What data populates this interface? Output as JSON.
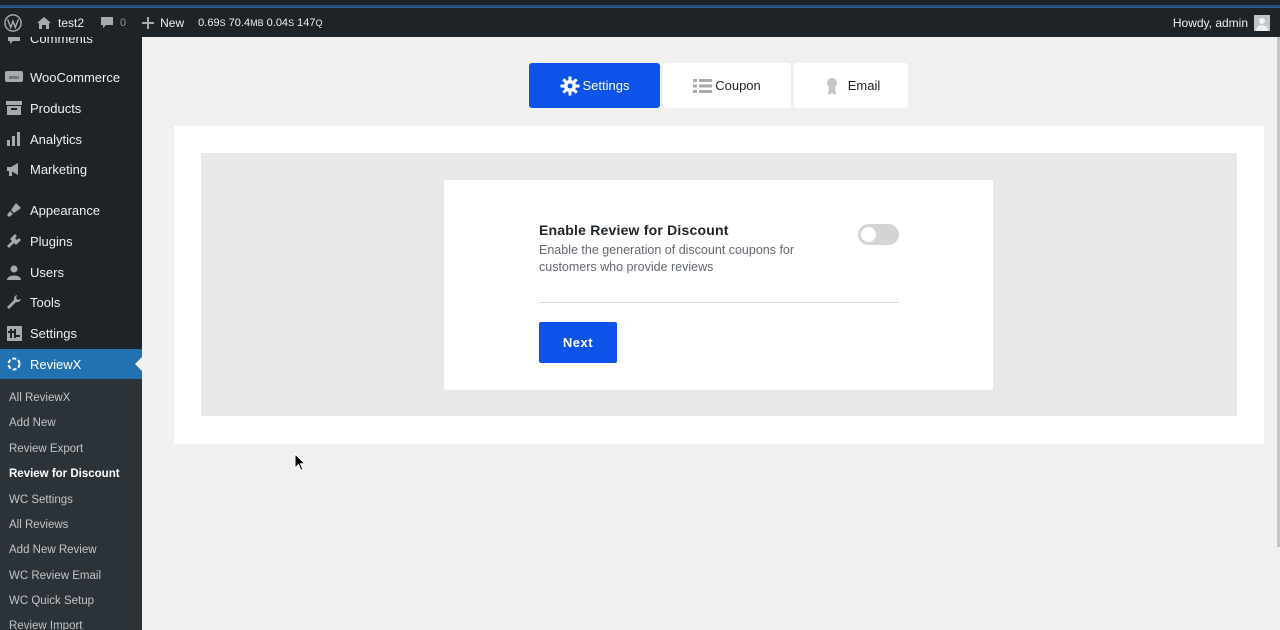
{
  "adminbar": {
    "site_name": "test2",
    "comments_count": "0",
    "new_label": "New",
    "perf_time": "0.69",
    "perf_time_unit": "S",
    "perf_mem": "70.4",
    "perf_mem_unit": "MB",
    "perf_query_time": "0.04",
    "perf_query_time_unit": "S",
    "perf_queries": "147",
    "perf_queries_unit": "Q",
    "howdy": "Howdy, admin"
  },
  "sidebar": {
    "items": [
      {
        "label": "Comments",
        "icon": "comments-icon"
      },
      {
        "label": "WooCommerce",
        "icon": "woocommerce-icon"
      },
      {
        "label": "Products",
        "icon": "products-icon"
      },
      {
        "label": "Analytics",
        "icon": "analytics-icon"
      },
      {
        "label": "Marketing",
        "icon": "marketing-icon"
      },
      {
        "label": "Appearance",
        "icon": "appearance-icon"
      },
      {
        "label": "Plugins",
        "icon": "plugins-icon"
      },
      {
        "label": "Users",
        "icon": "users-icon"
      },
      {
        "label": "Tools",
        "icon": "tools-icon"
      },
      {
        "label": "Settings",
        "icon": "settings-icon"
      },
      {
        "label": "ReviewX",
        "icon": "reviewx-icon"
      }
    ],
    "submenu": [
      "All ReviewX",
      "Add New",
      "Review Export",
      "Review for Discount",
      "WC Settings",
      "All Reviews",
      "Add New Review",
      "WC Review Email",
      "WC Quick Setup",
      "Review Import"
    ]
  },
  "tabs": {
    "settings": "Settings",
    "coupon": "Coupon",
    "email": "Email"
  },
  "setting": {
    "title": "Enable Review for Discount",
    "description": "Enable the generation of discount coupons for customers who provide reviews",
    "toggle_on": false
  },
  "next_button": "Next",
  "colors": {
    "accent": "#0d52e9",
    "wp_admin_blue": "#2271b1",
    "sidebar_bg": "#1d2327"
  }
}
